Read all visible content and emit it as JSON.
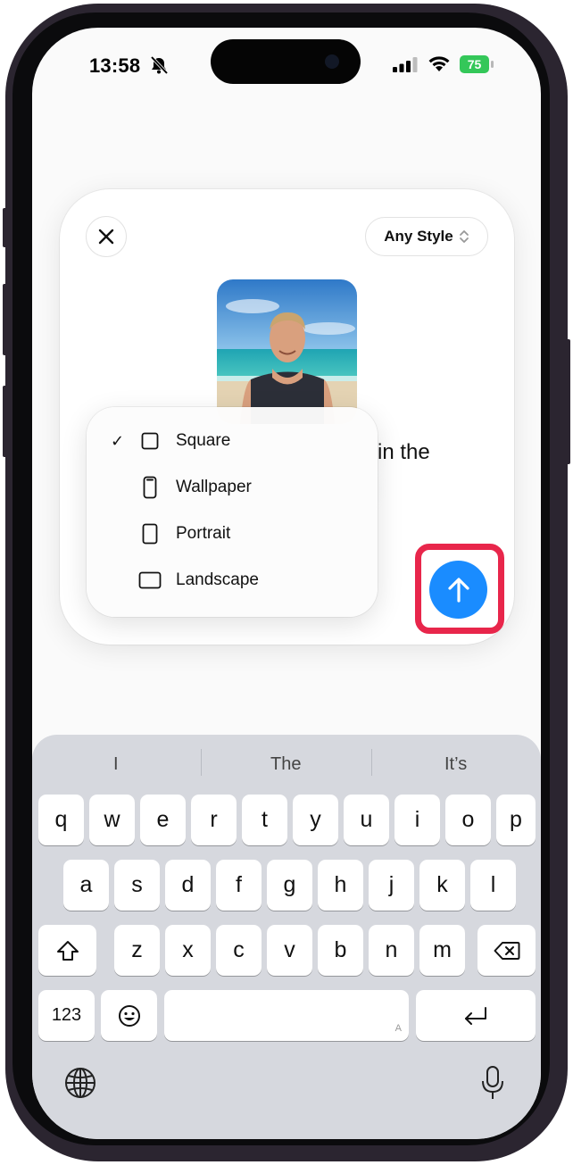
{
  "status_bar": {
    "time": "13:58",
    "battery_label": "75",
    "icons": [
      "bell-slash-icon",
      "cellular-signal-icon",
      "wifi-icon",
      "battery-charging-icon"
    ]
  },
  "card": {
    "close_icon": "close-icon",
    "style_selector_label": "Any Style",
    "style_selector_icon": "chevron-up-down-icon",
    "prompt_visible_text": "in the"
  },
  "aspect_menu": {
    "items": [
      {
        "label": "Square",
        "icon": "square-icon",
        "checked": true
      },
      {
        "label": "Wallpaper",
        "icon": "phone-icon",
        "checked": false
      },
      {
        "label": "Portrait",
        "icon": "portrait-rect-icon",
        "checked": false
      },
      {
        "label": "Landscape",
        "icon": "landscape-rect-icon",
        "checked": false
      }
    ],
    "check_mark": "✓"
  },
  "send_button": {
    "icon": "arrow-up-icon",
    "highlight_color": "#e8264b",
    "color": "#1a8cff"
  },
  "keyboard": {
    "suggestions": [
      "I",
      "The",
      "It’s"
    ],
    "row1": [
      "q",
      "w",
      "e",
      "r",
      "t",
      "y",
      "u",
      "i",
      "o",
      "p"
    ],
    "row2": [
      "a",
      "s",
      "d",
      "f",
      "g",
      "h",
      "j",
      "k",
      "l"
    ],
    "row3": [
      "z",
      "x",
      "c",
      "v",
      "b",
      "n",
      "m"
    ],
    "numbers_key": "123",
    "space_hint": "A",
    "icons": [
      "shift-icon",
      "delete-icon",
      "emoji-icon",
      "return-icon",
      "globe-icon",
      "microphone-icon"
    ]
  }
}
